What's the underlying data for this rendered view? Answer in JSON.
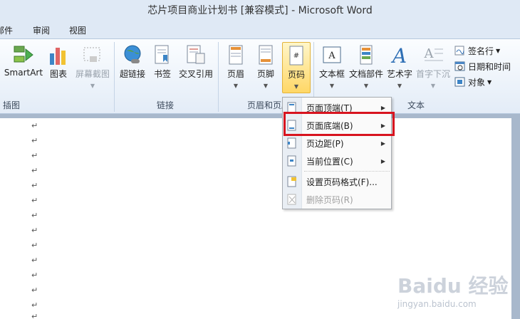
{
  "window": {
    "title": "芯片项目商业计划书 [兼容模式] - Microsoft Word"
  },
  "tabs": [
    "邮件",
    "审阅",
    "视图"
  ],
  "ribbon": {
    "groups": {
      "illustrations": {
        "label": "插图",
        "buttons": [
          "SmartArt",
          "图表",
          "屏幕截图"
        ]
      },
      "links": {
        "label": "链接",
        "buttons": [
          "超链接",
          "书签",
          "交叉引用"
        ]
      },
      "header_footer": {
        "label": "页眉和页脚",
        "buttons": [
          "页眉",
          "页脚",
          "页码"
        ]
      },
      "text": {
        "label": "文本",
        "buttons": [
          "文本框",
          "文档部件",
          "艺术字",
          "首字下沉"
        ],
        "small_buttons": [
          "签名行",
          "日期和时间",
          "对象"
        ]
      }
    }
  },
  "page_number_menu": {
    "items": [
      {
        "label": "页面顶端(T)",
        "submenu": true
      },
      {
        "label": "页面底端(B)",
        "submenu": true
      },
      {
        "label": "页边距(P)",
        "submenu": true
      },
      {
        "label": "当前位置(C)",
        "submenu": true
      },
      {
        "label": "设置页码格式(F)...",
        "submenu": false
      },
      {
        "label": "删除页码(R)",
        "submenu": false,
        "disabled": true
      }
    ]
  },
  "paragraph_mark": "↵",
  "watermark": {
    "text": "Baidu 经验",
    "subtext": "jingyan.baidu.com"
  },
  "colors": {
    "ribbon_bg": "#e3ecf7",
    "highlight": "#d8141f",
    "active_button": "#ffd766"
  }
}
